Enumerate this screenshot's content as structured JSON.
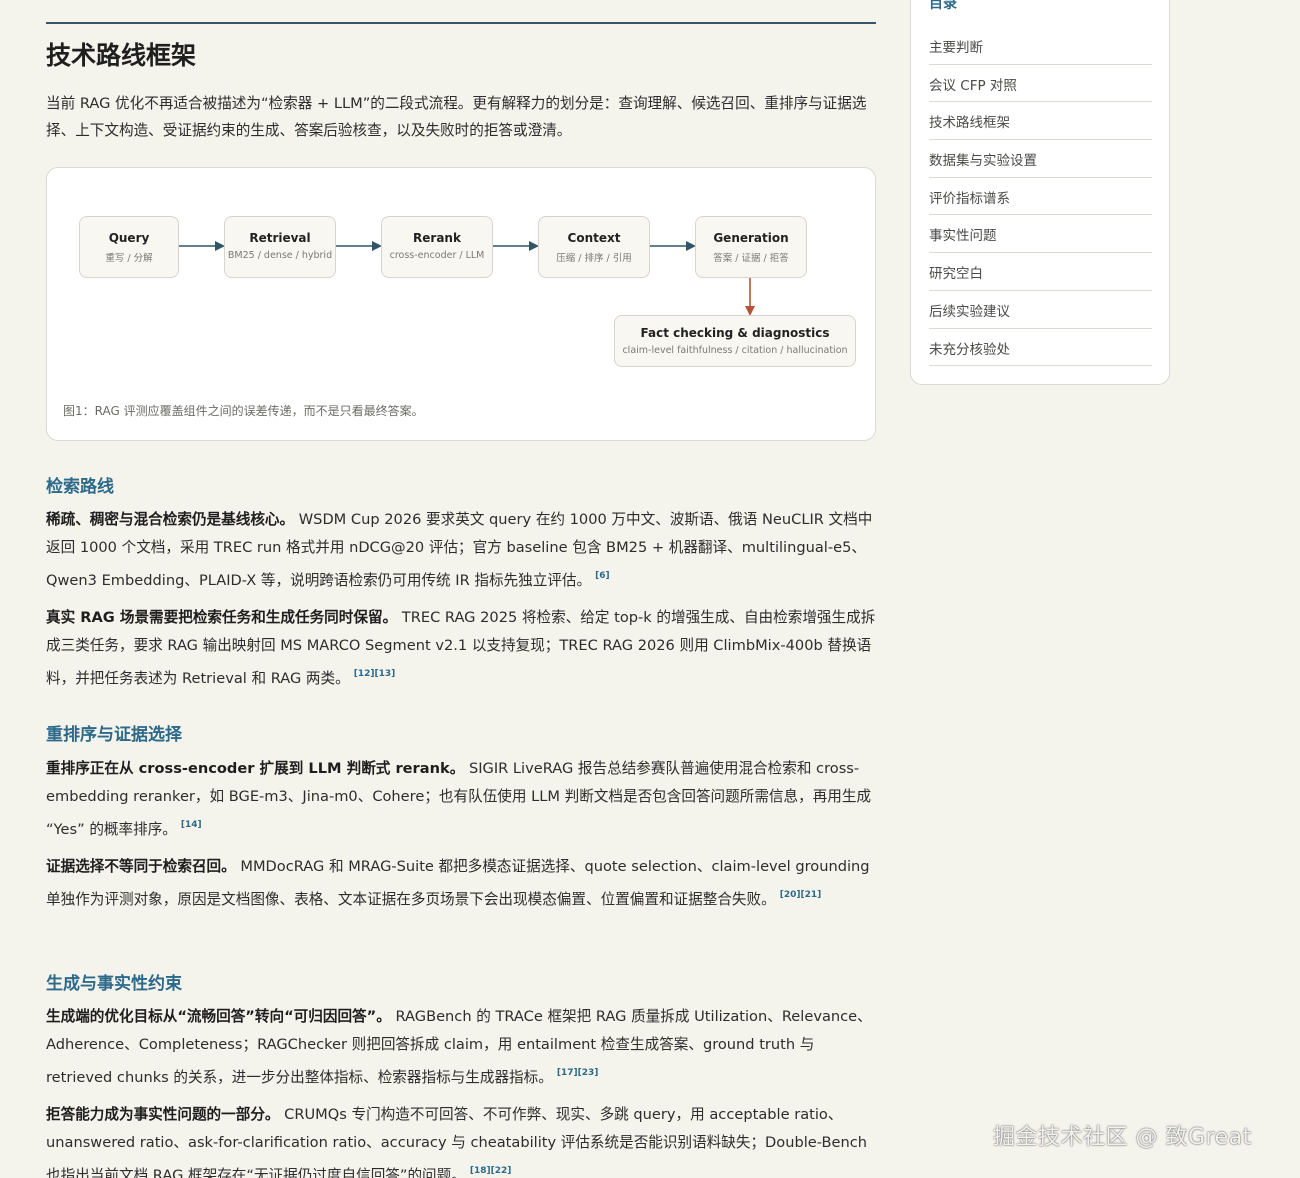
{
  "toc": {
    "title": "目录",
    "items": [
      "主要判断",
      "会议 CFP 对照",
      "技术路线框架",
      "数据集与实验设置",
      "评价指标谱系",
      "事实性问题",
      "研究空白",
      "后续实验建议",
      "未充分核验处"
    ]
  },
  "section": {
    "title": "技术路线框架",
    "intro": "当前 RAG 优化不再适合被描述为“检索器 + LLM”的二段式流程。更有解释力的划分是：查询理解、候选召回、重排序与证据选择、上下文构造、受证据约束的生成、答案后验核查，以及失败时的拒答或澄清。"
  },
  "figure": {
    "nodes": [
      {
        "title": "Query",
        "sub": "重写 / 分解"
      },
      {
        "title": "Retrieval",
        "sub": "BM25 / dense / hybrid"
      },
      {
        "title": "Rerank",
        "sub": "cross-encoder / LLM"
      },
      {
        "title": "Context",
        "sub": "压缩 / 排序 / 引用"
      },
      {
        "title": "Generation",
        "sub": "答案 / 证据 / 拒答"
      }
    ],
    "fact": {
      "title": "Fact checking & diagnostics",
      "sub": "claim-level faithfulness / citation / hallucination"
    },
    "caption": "图1：RAG 评测应覆盖组件之间的误差传递，而不是只看最终答案。",
    "arrow_color": "#2f5566",
    "down_arrow_color": "#b5533a"
  },
  "subsections": [
    {
      "title": "检索路线",
      "paragraphs": [
        {
          "lead": "稀疏、稠密与混合检索仍是基线核心。",
          "text": "WSDM Cup 2026 要求英文 query 在约 1000 万中文、波斯语、俄语 NeuCLIR 文档中返回 1000 个文档，采用 TREC run 格式并用 nDCG@20 评估；官方 baseline 包含 BM25 + 机器翻译、multilingual-e5、Qwen3 Embedding、PLAID-X 等，说明跨语检索仍可用传统 IR 指标先独立评估。",
          "cite": "[6]"
        },
        {
          "lead": "真实 RAG 场景需要把检索任务和生成任务同时保留。",
          "text": "TREC RAG 2025 将检索、给定 top-k 的增强生成、自由检索增强生成拆成三类任务，要求 RAG 输出映射回 MS MARCO Segment v2.1 以支持复现；TREC RAG 2026 则用 ClimbMix-400b 替换语料，并把任务表述为 Retrieval 和 RAG 两类。",
          "cite": "[12][13]"
        }
      ]
    },
    {
      "title": "重排序与证据选择",
      "paragraphs": [
        {
          "lead": "重排序正在从 cross-encoder 扩展到 LLM 判断式 rerank。",
          "text": "SIGIR LiveRAG 报告总结参赛队普遍使用混合检索和 cross-embedding reranker，如 BGE-m3、Jina-m0、Cohere；也有队伍使用 LLM 判断文档是否包含回答问题所需信息，再用生成 “Yes” 的概率排序。",
          "cite": "[14]"
        },
        {
          "lead": "证据选择不等同于检索召回。",
          "text": "MMDocRAG 和 MRAG-Suite 都把多模态证据选择、quote selection、claim-level grounding 单独作为评测对象，原因是文档图像、表格、文本证据在多页场景下会出现模态偏置、位置偏置和证据整合失败。",
          "cite": "[20][21]"
        }
      ]
    },
    {
      "title": "生成与事实性约束",
      "paragraphs": [
        {
          "lead": "生成端的优化目标从“流畅回答”转向“可归因回答”。",
          "text": "RAGBench 的 TRACe 框架把 RAG 质量拆成 Utilization、Relevance、Adherence、Completeness；RAGChecker 则把回答拆成 claim，用 entailment 检查生成答案、ground truth 与 retrieved chunks 的关系，进一步分出整体指标、检索器指标与生成器指标。",
          "cite": "[17][23]"
        },
        {
          "lead": "拒答能力成为事实性问题的一部分。",
          "text": "CRUMQs 专门构造不可回答、不可作弊、现实、多跳 query，用 acceptable ratio、unanswered ratio、ask-for-clarification ratio、accuracy 与 cheatability 评估系统是否能识别语料缺失；Double-Bench 也指出当前文档 RAG 框架存在“无证据仍过度自信回答”的问题。",
          "cite": "[18][22]"
        }
      ]
    }
  ],
  "watermark": "掘金技术社区 @ 致Great"
}
